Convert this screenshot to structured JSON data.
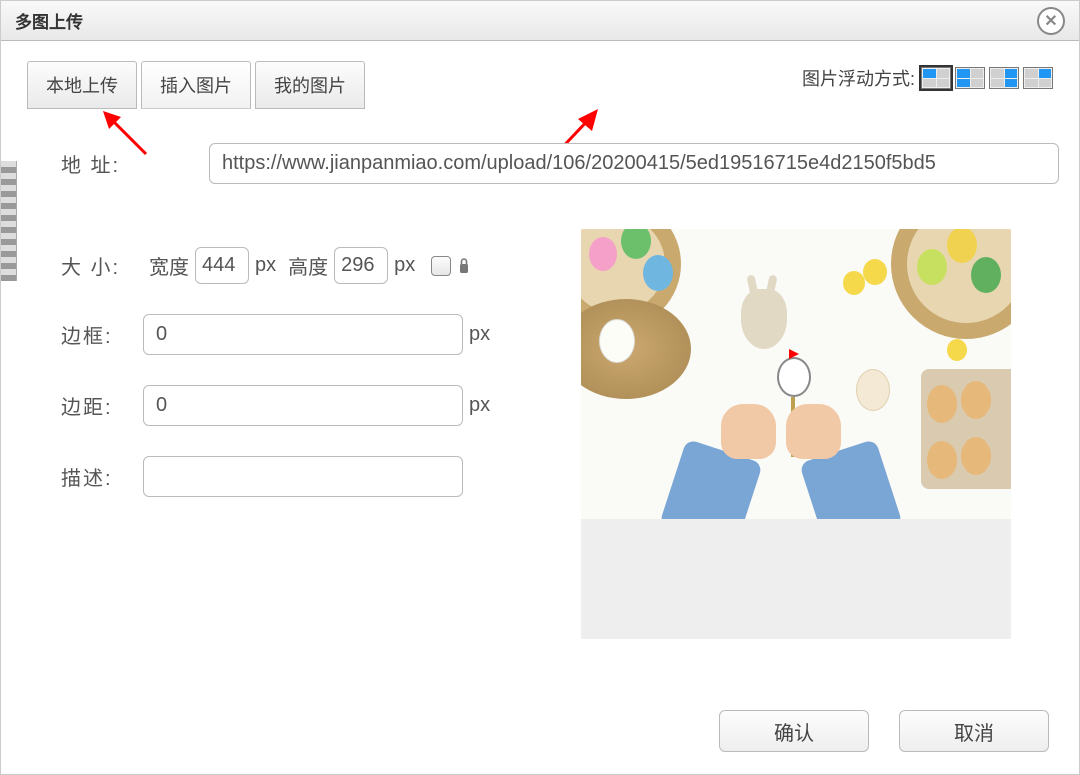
{
  "dialog": {
    "title": "多图上传"
  },
  "tabs": [
    {
      "label": "本地上传"
    },
    {
      "label": "插入图片"
    },
    {
      "label": "我的图片"
    }
  ],
  "float_mode_label": "图片浮动方式:",
  "form": {
    "url_label": "地 址:",
    "url_value": "https://www.jianpanmiao.com/upload/106/20200415/5ed19516715e4d2150f5bd5",
    "size_label": "大 小:",
    "width_label": "宽度",
    "width_value": "444",
    "height_label": "高度",
    "height_value": "296",
    "px": "px",
    "border_label": "边框:",
    "border_value": "0",
    "margin_label": "边距:",
    "margin_value": "0",
    "desc_label": "描述:",
    "desc_value": ""
  },
  "footer": {
    "ok": "确认",
    "cancel": "取消"
  }
}
